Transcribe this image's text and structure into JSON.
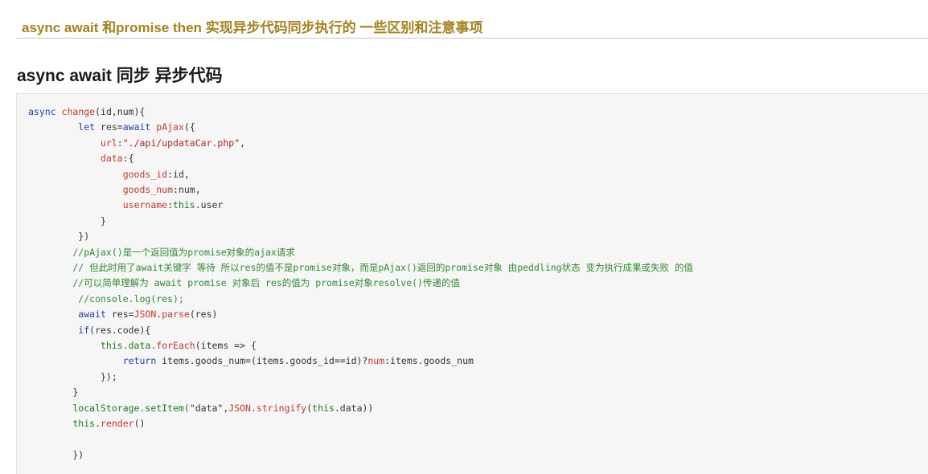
{
  "article": {
    "title": "async await 和promise then 实现异步代码同步执行的 一些区别和注意事项"
  },
  "section": {
    "heading": "async await 同步 异步代码"
  },
  "code": {
    "language": "javascript",
    "lines": [
      [
        {
          "t": "async ",
          "c": "kw"
        },
        {
          "t": "change",
          "c": "fn"
        },
        {
          "t": "(id,num){",
          "c": "plain"
        }
      ],
      [
        {
          "t": "         let ",
          "c": "kw"
        },
        {
          "t": "res=",
          "c": "plain"
        },
        {
          "t": "await ",
          "c": "kw"
        },
        {
          "t": "pAjax",
          "c": "fn"
        },
        {
          "t": "({",
          "c": "plain"
        }
      ],
      [
        {
          "t": "             url",
          "c": "prop"
        },
        {
          "t": ":",
          "c": "plain"
        },
        {
          "t": "\"./api/updataCar.php\"",
          "c": "str"
        },
        {
          "t": ",",
          "c": "plain"
        }
      ],
      [
        {
          "t": "             data",
          "c": "prop"
        },
        {
          "t": ":{",
          "c": "plain"
        }
      ],
      [
        {
          "t": "                 goods_id",
          "c": "prop"
        },
        {
          "t": ":id,",
          "c": "plain"
        }
      ],
      [
        {
          "t": "                 goods_num",
          "c": "prop"
        },
        {
          "t": ":num,",
          "c": "plain"
        }
      ],
      [
        {
          "t": "                 username",
          "c": "prop"
        },
        {
          "t": ":",
          "c": "plain"
        },
        {
          "t": "this",
          "c": "th"
        },
        {
          "t": ".user",
          "c": "plain"
        }
      ],
      [
        {
          "t": "             }",
          "c": "plain"
        }
      ],
      [
        {
          "t": "         })",
          "c": "plain"
        }
      ],
      [
        {
          "t": "        //pAjax()是一个返回值为promise对象的ajax请求",
          "c": "cm"
        }
      ],
      [
        {
          "t": "        // 但此时用了await关键字 等待 所以res的值不是promise对象，而是pAjax()返回的promise对象 由peddling状态 变为执行成果或失败 的值",
          "c": "cm"
        }
      ],
      [
        {
          "t": "        //可以简单理解为 await promise 对象后 res的值为 promise对象resolve()传递的值",
          "c": "cm"
        }
      ],
      [
        {
          "t": "         //console.log(res);",
          "c": "cm"
        }
      ],
      [
        {
          "t": "         await ",
          "c": "kw"
        },
        {
          "t": "res=",
          "c": "plain"
        },
        {
          "t": "JSON",
          "c": "fn"
        },
        {
          "t": ".",
          "c": "plain"
        },
        {
          "t": "parse",
          "c": "fn"
        },
        {
          "t": "(res)",
          "c": "plain"
        }
      ],
      [
        {
          "t": "         if",
          "c": "kw"
        },
        {
          "t": "(res.code){",
          "c": "plain"
        }
      ],
      [
        {
          "t": "             this",
          "c": "th"
        },
        {
          "t": ".data.",
          "c": "th"
        },
        {
          "t": "forEach",
          "c": "fn"
        },
        {
          "t": "(items => {",
          "c": "plain"
        }
      ],
      [
        {
          "t": "                 return ",
          "c": "kw"
        },
        {
          "t": "items.goods_num=(items.goods_id==id)?",
          "c": "plain"
        },
        {
          "t": "num",
          "c": "fn"
        },
        {
          "t": ":items.goods_num",
          "c": "plain"
        }
      ],
      [
        {
          "t": "             });",
          "c": "plain"
        }
      ],
      [
        {
          "t": "        }",
          "c": "plain"
        }
      ],
      [
        {
          "t": "        localStorage.setItem(",
          "c": "th"
        },
        {
          "t": "\"data\"",
          "c": "plain"
        },
        {
          "t": ",",
          "c": "plain"
        },
        {
          "t": "JSON",
          "c": "fn"
        },
        {
          "t": ".",
          "c": "plain"
        },
        {
          "t": "stringify",
          "c": "fn"
        },
        {
          "t": "(",
          "c": "plain"
        },
        {
          "t": "this",
          "c": "th"
        },
        {
          "t": ".data))",
          "c": "plain"
        }
      ],
      [
        {
          "t": "        this",
          "c": "th"
        },
        {
          "t": ".",
          "c": "plain"
        },
        {
          "t": "render",
          "c": "fn"
        },
        {
          "t": "()",
          "c": "plain"
        }
      ],
      [
        {
          "t": "",
          "c": "plain"
        }
      ],
      [
        {
          "t": "        })",
          "c": "plain"
        }
      ]
    ]
  }
}
